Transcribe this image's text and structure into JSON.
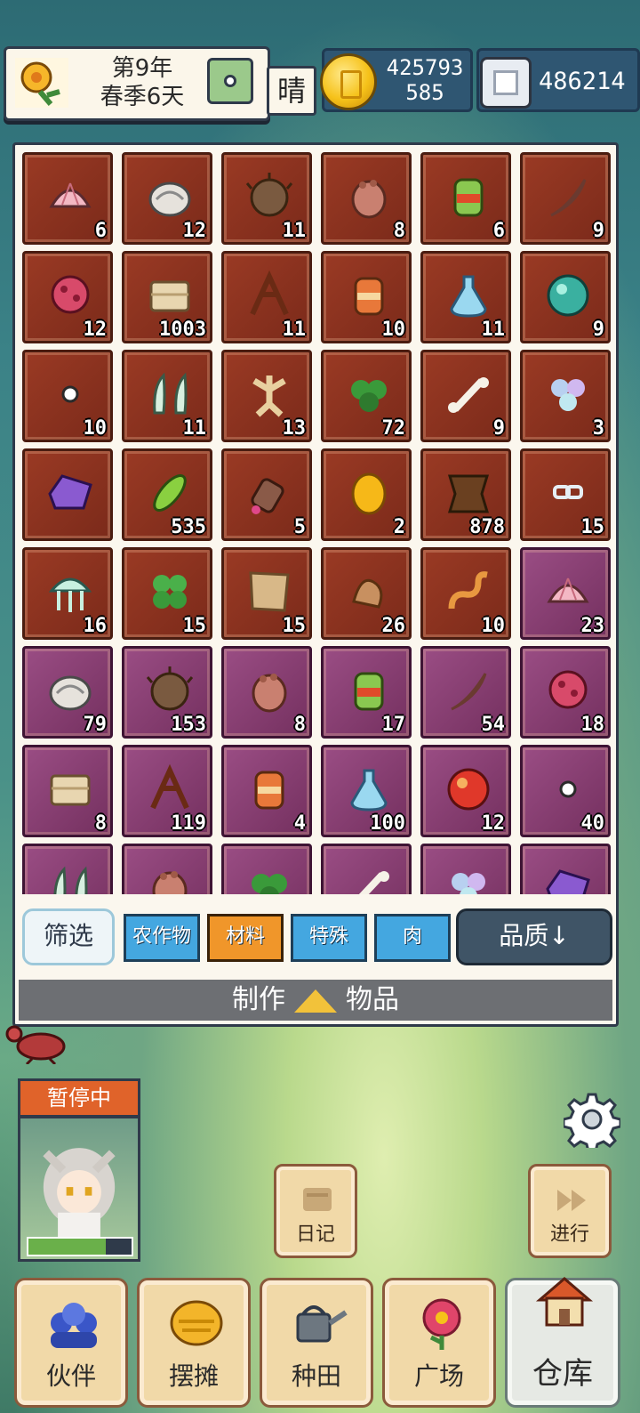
{
  "hud": {
    "year": "第9年",
    "season_day": "春季6天",
    "weather": "晴",
    "gold_line1": "425793",
    "gold_line2": "585",
    "silver": "486214"
  },
  "inventory": {
    "items": [
      {
        "icon": "seashell-icon",
        "count": "6",
        "rarity": "common"
      },
      {
        "icon": "snail-shell-icon",
        "count": "12",
        "rarity": "common"
      },
      {
        "icon": "hedgehog-icon",
        "count": "11",
        "rarity": "common"
      },
      {
        "icon": "paw-meat-icon",
        "count": "8",
        "rarity": "common"
      },
      {
        "icon": "seed-jar-icon",
        "count": "6",
        "rarity": "common"
      },
      {
        "icon": "feather-icon",
        "count": "9",
        "rarity": "common"
      },
      {
        "icon": "coral-icon",
        "count": "12",
        "rarity": "common"
      },
      {
        "icon": "cloth-bundle-icon",
        "count": "1003",
        "rarity": "common"
      },
      {
        "icon": "branch-icon",
        "count": "11",
        "rarity": "common"
      },
      {
        "icon": "sauce-jar-icon",
        "count": "10",
        "rarity": "common"
      },
      {
        "icon": "potion-flask-icon",
        "count": "11",
        "rarity": "common"
      },
      {
        "icon": "green-orb-icon",
        "count": "9",
        "rarity": "common"
      },
      {
        "icon": "pearl-icon",
        "count": "10",
        "rarity": "common"
      },
      {
        "icon": "fang-icon",
        "count": "11",
        "rarity": "common"
      },
      {
        "icon": "ginseng-root-icon",
        "count": "13",
        "rarity": "common"
      },
      {
        "icon": "herb-leaves-icon",
        "count": "72",
        "rarity": "common"
      },
      {
        "icon": "bone-icon",
        "count": "9",
        "rarity": "common"
      },
      {
        "icon": "crystal-flower-icon",
        "count": "3",
        "rarity": "common"
      },
      {
        "icon": "amethyst-icon",
        "count": "",
        "rarity": "common"
      },
      {
        "icon": "green-pod-icon",
        "count": "535",
        "rarity": "common"
      },
      {
        "icon": "meat-leg-icon",
        "count": "5",
        "rarity": "common"
      },
      {
        "icon": "golden-egg-icon",
        "count": "2",
        "rarity": "common"
      },
      {
        "icon": "leather-hide-icon",
        "count": "878",
        "rarity": "common"
      },
      {
        "icon": "chain-link-icon",
        "count": "15",
        "rarity": "common"
      },
      {
        "icon": "jellyfish-icon",
        "count": "16",
        "rarity": "common"
      },
      {
        "icon": "clover-icon",
        "count": "15",
        "rarity": "common"
      },
      {
        "icon": "paper-scrap-icon",
        "count": "15",
        "rarity": "common"
      },
      {
        "icon": "ginger-root-icon",
        "count": "26",
        "rarity": "common"
      },
      {
        "icon": "worm-icon",
        "count": "10",
        "rarity": "common"
      },
      {
        "icon": "seashell-icon",
        "count": "23",
        "rarity": "rare"
      },
      {
        "icon": "snail-shell-icon",
        "count": "79",
        "rarity": "rare"
      },
      {
        "icon": "hedgehog-icon",
        "count": "153",
        "rarity": "rare"
      },
      {
        "icon": "paw-meat-icon",
        "count": "8",
        "rarity": "rare"
      },
      {
        "icon": "seed-jar-icon",
        "count": "17",
        "rarity": "rare"
      },
      {
        "icon": "feather-icon",
        "count": "54",
        "rarity": "rare"
      },
      {
        "icon": "coral-icon",
        "count": "18",
        "rarity": "rare"
      },
      {
        "icon": "cloth-bundle-icon",
        "count": "8",
        "rarity": "rare"
      },
      {
        "icon": "branch-icon",
        "count": "119",
        "rarity": "rare"
      },
      {
        "icon": "sauce-jar-icon",
        "count": "4",
        "rarity": "rare"
      },
      {
        "icon": "potion-flask-icon",
        "count": "100",
        "rarity": "rare"
      },
      {
        "icon": "red-orb-icon",
        "count": "12",
        "rarity": "rare"
      },
      {
        "icon": "pearl-icon",
        "count": "40",
        "rarity": "rare"
      },
      {
        "icon": "fang-icon",
        "count": "",
        "rarity": "rare"
      },
      {
        "icon": "paw-meat-icon",
        "count": "",
        "rarity": "rare"
      },
      {
        "icon": "herb-leaves-icon",
        "count": "",
        "rarity": "rare"
      },
      {
        "icon": "bone-icon",
        "count": "",
        "rarity": "rare"
      },
      {
        "icon": "crystal-flower-icon",
        "count": "",
        "rarity": "rare"
      },
      {
        "icon": "amethyst-icon",
        "count": "",
        "rarity": "rare"
      }
    ],
    "filter_label": "筛选",
    "tabs": [
      {
        "label": "农作物",
        "active": false
      },
      {
        "label": "材料",
        "active": true
      },
      {
        "label": "特殊",
        "active": false
      },
      {
        "label": "肉",
        "active": false
      }
    ],
    "quality_label": "品质↓",
    "craft_left": "制作",
    "craft_right": "物品"
  },
  "scene": {
    "status": "暂停中",
    "hp_fraction": 0.75,
    "diary_label": "日记",
    "proceed_label": "进行"
  },
  "nav": [
    {
      "label": "伙伴",
      "icon": "partners-icon",
      "active": false
    },
    {
      "label": "摆摊",
      "icon": "stall-icon",
      "active": false
    },
    {
      "label": "种田",
      "icon": "watering-can-icon",
      "active": false
    },
    {
      "label": "广场",
      "icon": "flower-icon",
      "active": false
    },
    {
      "label": "仓库",
      "icon": "house-icon",
      "active": true
    }
  ],
  "colors": {
    "common_slot": "#8a3320",
    "rare_slot": "#86406f",
    "active_tab": "#f0962a",
    "tab": "#44a7e0"
  }
}
